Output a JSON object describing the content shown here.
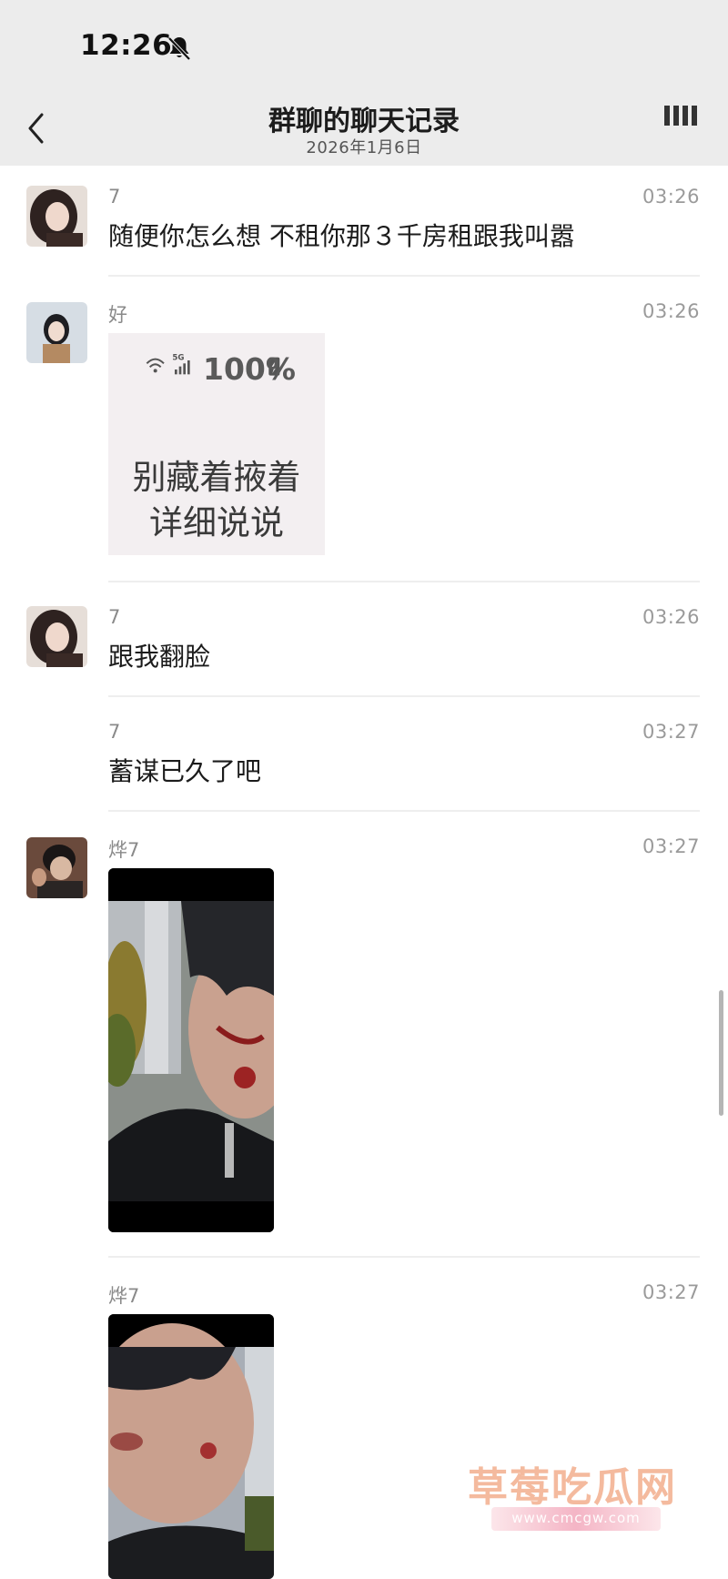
{
  "status_bar": {
    "time": "12:26"
  },
  "nav": {
    "title": "群聊的聊天记录",
    "subtitle": "2026年1月6日"
  },
  "messages": [
    {
      "sender": "7",
      "time": "03:26",
      "text": "随便你怎么想 不租你那３千房租跟我叫嚣"
    },
    {
      "sender": "好",
      "time": "03:26",
      "sticker": {
        "status_percent": "100%",
        "line1": "别藏着掖着",
        "line2": "详细说说"
      }
    },
    {
      "sender": "7",
      "time": "03:26",
      "text": "跟我翻脸"
    },
    {
      "sender": "7",
      "time": "03:27",
      "text": "蓄谋已久了吧"
    },
    {
      "sender": "烨7",
      "time": "03:27"
    },
    {
      "sender": "烨7",
      "time": "03:27"
    }
  ],
  "watermark": {
    "title": "草莓吃瓜网",
    "url": "www.cmcgw.com"
  }
}
